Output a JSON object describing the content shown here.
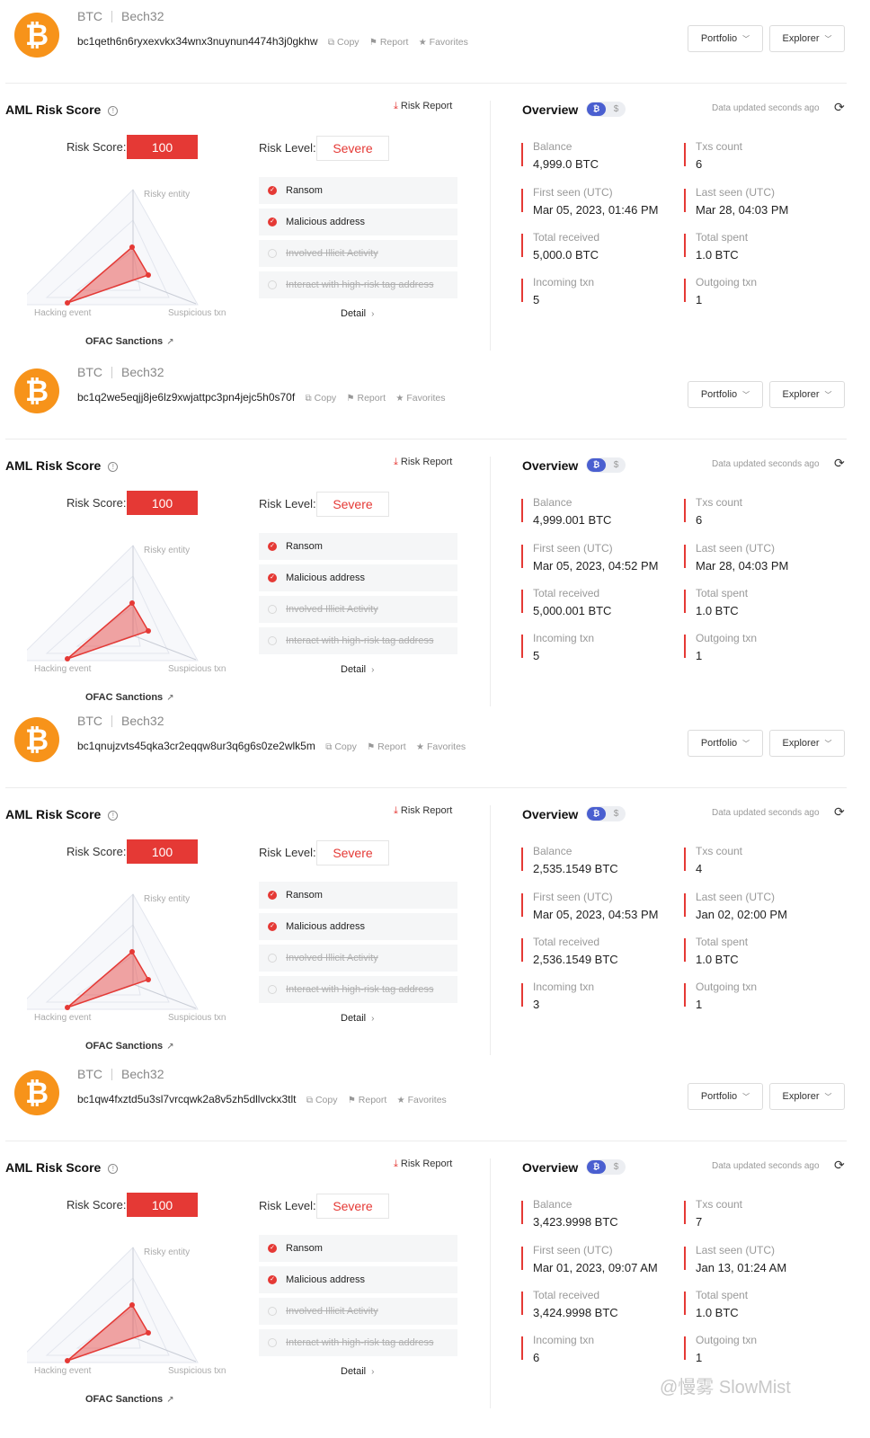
{
  "labels": {
    "chain": "BTC",
    "format": "Bech32",
    "copy": "Copy",
    "report": "Report",
    "favorites": "Favorites",
    "portfolio": "Portfolio",
    "explorer": "Explorer",
    "aml_title": "AML Risk Score",
    "risk_report": "Risk Report",
    "risk_score_label": "Risk Score:",
    "risk_level_label": "Risk Level:",
    "radar_risky": "Risky entity",
    "radar_hacking": "Hacking event",
    "radar_suspicious": "Suspicious txn",
    "ofac": "OFAC Sanctions",
    "detail": "Detail",
    "overview_title": "Overview",
    "toggle_btc": "₿",
    "toggle_usd": "$",
    "data_updated": "Data updated seconds ago",
    "balance": "Balance",
    "txs_count": "Txs count",
    "first_seen": "First seen (UTC)",
    "last_seen": "Last seen (UTC)",
    "total_received": "Total received",
    "total_spent": "Total spent",
    "incoming_txn": "Incoming txn",
    "outgoing_txn": "Outgoing txn"
  },
  "colors": {
    "accent_red": "#e53935",
    "btc_orange": "#f7931a",
    "toggle_blue": "#4a5fd0"
  },
  "blocks": [
    {
      "address": "bc1qeth6n6ryxexvkx34wnx3nuynun4474h3j0gkhw",
      "risk_score": "100",
      "risk_level": "Severe",
      "tags": [
        {
          "label": "Ransom",
          "active": true
        },
        {
          "label": "Malicious address",
          "active": true
        },
        {
          "label": "Involved Illicit Activity",
          "active": false
        },
        {
          "label": "Interact with high-risk tag address",
          "active": false
        }
      ],
      "balance": "4,999.0 BTC",
      "txs_count": "6",
      "first_seen": "Mar 05, 2023, 01:46 PM",
      "last_seen": "Mar 28, 04:03 PM",
      "total_received": "5,000.0 BTC",
      "total_spent": "1.0 BTC",
      "incoming_txn": "5",
      "outgoing_txn": "1"
    },
    {
      "address": "bc1q2we5eqjj8je6lz9xwjattpc3pn4jejc5h0s70f",
      "risk_score": "100",
      "risk_level": "Severe",
      "tags": [
        {
          "label": "Ransom",
          "active": true
        },
        {
          "label": "Malicious address",
          "active": true
        },
        {
          "label": "Involved Illicit Activity",
          "active": false
        },
        {
          "label": "Interact with high-risk tag address",
          "active": false
        }
      ],
      "balance": "4,999.001 BTC",
      "txs_count": "6",
      "first_seen": "Mar 05, 2023, 04:52 PM",
      "last_seen": "Mar 28, 04:03 PM",
      "total_received": "5,000.001 BTC",
      "total_spent": "1.0 BTC",
      "incoming_txn": "5",
      "outgoing_txn": "1"
    },
    {
      "address": "bc1qnujzvts45qka3cr2eqqw8ur3q6g6s0ze2wlk5m",
      "risk_score": "100",
      "risk_level": "Severe",
      "tags": [
        {
          "label": "Ransom",
          "active": true
        },
        {
          "label": "Malicious address",
          "active": true
        },
        {
          "label": "Involved Illicit Activity",
          "active": false
        },
        {
          "label": "Interact with high-risk tag address",
          "active": false
        }
      ],
      "balance": "2,535.1549 BTC",
      "txs_count": "4",
      "first_seen": "Mar 05, 2023, 04:53 PM",
      "last_seen": "Jan 02, 02:00 PM",
      "total_received": "2,536.1549 BTC",
      "total_spent": "1.0 BTC",
      "incoming_txn": "3",
      "outgoing_txn": "1"
    },
    {
      "address": "bc1qw4fxztd5u3sl7vrcqwk2a8v5zh5dllvckx3tlt",
      "risk_score": "100",
      "risk_level": "Severe",
      "tags": [
        {
          "label": "Ransom",
          "active": true
        },
        {
          "label": "Malicious address",
          "active": true
        },
        {
          "label": "Involved Illicit Activity",
          "active": false
        },
        {
          "label": "Interact with high-risk tag address",
          "active": false
        }
      ],
      "balance": "3,423.9998 BTC",
      "txs_count": "7",
      "first_seen": "Mar 01, 2023, 09:07 AM",
      "last_seen": "Jan 13, 01:24 AM",
      "total_received": "3,424.9998 BTC",
      "total_spent": "1.0 BTC",
      "incoming_txn": "6",
      "outgoing_txn": "1"
    }
  ],
  "watermark": "@慢雾 SlowMist"
}
